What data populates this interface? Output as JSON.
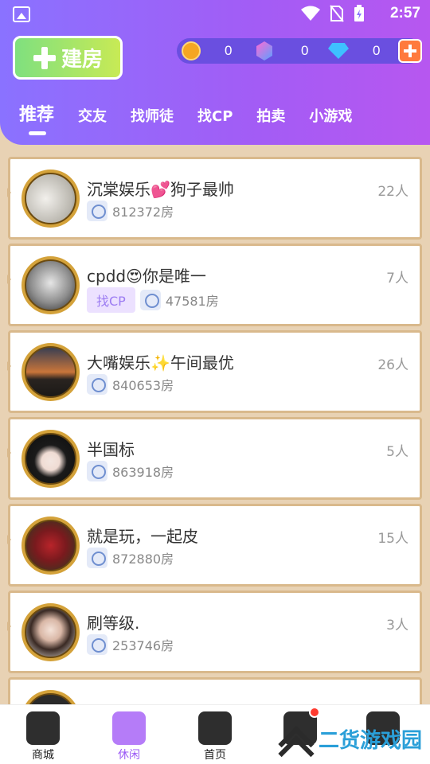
{
  "status": {
    "time": "2:57"
  },
  "header": {
    "build_label": "建房",
    "wallet": [
      {
        "icon": "coin-icon",
        "value": "0"
      },
      {
        "icon": "gem-icon",
        "value": "0"
      },
      {
        "icon": "diamond-icon",
        "value": "0"
      }
    ],
    "tabs": [
      "推荐",
      "交友",
      "找师徒",
      "找CP",
      "拍卖",
      "小游戏"
    ]
  },
  "rooms": [
    {
      "name": "沉棠娱乐💕狗子最帅",
      "count": "22人",
      "id": "812372房",
      "tag": ""
    },
    {
      "name": "cpdd😍你是唯一",
      "count": "7人",
      "id": "47581房",
      "tag": "找CP"
    },
    {
      "name": "大嘴娱乐✨午间最优",
      "count": "26人",
      "id": "840653房",
      "tag": ""
    },
    {
      "name": "半国标",
      "count": "5人",
      "id": "863918房",
      "tag": ""
    },
    {
      "name": "就是玩，一起皮",
      "count": "15人",
      "id": "872880房",
      "tag": ""
    },
    {
      "name": "刷等级.",
      "count": "3人",
      "id": "253746房",
      "tag": ""
    }
  ],
  "nav": [
    "商城",
    "休闲",
    "首页"
  ],
  "watermark": "二货游戏园",
  "colors": {
    "accent": "#9b59f5",
    "header_start": "#8a72ff",
    "header_end": "#b757f0",
    "ring": "#d4a23a"
  }
}
